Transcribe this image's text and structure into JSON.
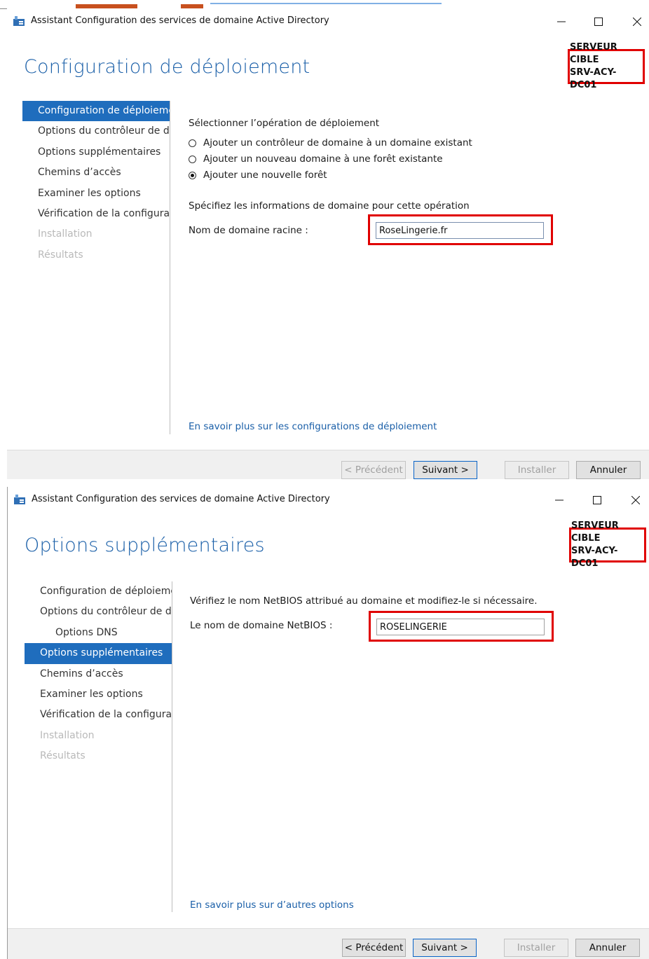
{
  "window_title": "Assistant Configuration des services de domaine Active Directory",
  "target_server": {
    "line1": "SERVEUR CIBLE",
    "line2": "SRV-ACY-DC01"
  },
  "controls": {
    "minimize": "–",
    "maximize": "☐",
    "close": "✕"
  },
  "buttons": {
    "previous": "< Précédent",
    "next": "Suivant >",
    "install": "Installer",
    "cancel": "Annuler"
  },
  "dialog1": {
    "page_title": "Configuration de déploiement",
    "nav": [
      "Configuration de déploiement",
      "Options du contrôleur de domaine",
      "Options supplémentaires",
      "Chemins d’accès",
      "Examiner les options",
      "Vérification de la configuration",
      "Installation",
      "Résultats"
    ],
    "select_operation_label": "Sélectionner l’opération de déploiement",
    "radios": [
      {
        "label": "Ajouter un contrôleur de domaine à un domaine existant",
        "checked": false
      },
      {
        "label": "Ajouter un nouveau domaine à une forêt existante",
        "checked": false
      },
      {
        "label": "Ajouter une nouvelle forêt",
        "checked": true
      }
    ],
    "domain_info_label": "Spécifiez les informations de domaine pour cette opération",
    "root_domain_label": "Nom de domaine racine :",
    "root_domain_value": "RoseLingerie.fr",
    "more_link": "En savoir plus sur les configurations de déploiement"
  },
  "dialog2": {
    "page_title": "Options supplémentaires",
    "nav": [
      "Configuration de déploiement",
      "Options du contrôleur de domaine",
      "Options DNS",
      "Options supplémentaires",
      "Chemins d’accès",
      "Examiner les options",
      "Vérification de la configuration",
      "Installation",
      "Résultats"
    ],
    "netbios_instruction": "Vérifiez le nom NetBIOS attribué au domaine et modifiez-le si nécessaire.",
    "netbios_label": "Le nom de domaine NetBIOS :",
    "netbios_value": "ROSELINGERIE",
    "more_link": "En savoir plus sur d’autres options"
  }
}
